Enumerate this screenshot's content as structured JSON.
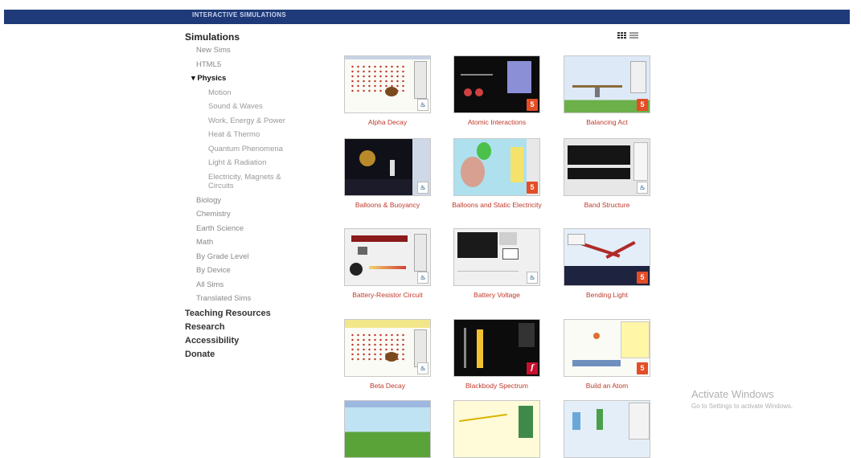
{
  "header": {
    "brand": "INTERACTIVE SIMULATIONS"
  },
  "sidebar": {
    "simulations_label": "Simulations",
    "level1_top": [
      "New Sims",
      "HTML5"
    ],
    "physics_label": "▾ Physics",
    "physics_children": [
      "Motion",
      "Sound & Waves",
      "Work, Energy & Power",
      "Heat & Thermo",
      "Quantum Phenomena",
      "Light & Radiation"
    ],
    "physics_last_child": "Electricity, Magnets & Circuits",
    "level1_rest": [
      "Biology",
      "Chemistry",
      "Earth Science",
      "Math",
      "By Grade Level",
      "By Device",
      "All Sims",
      "Translated Sims"
    ],
    "bottom_links": [
      "Teaching Resources",
      "Research",
      "Accessibility",
      "Donate"
    ]
  },
  "view_toggle": {
    "grid_icon": "grid-view-icon",
    "list_icon": "list-view-icon"
  },
  "sims": [
    {
      "title": "Alpha Decay",
      "badge": "java",
      "badge_text": "♨"
    },
    {
      "title": "Atomic Interactions",
      "badge": "html5",
      "badge_text": "5"
    },
    {
      "title": "Balancing Act",
      "badge": "html5",
      "badge_text": "5"
    },
    {
      "title": "Balloons & Buoyancy",
      "badge": "java",
      "badge_text": "♨"
    },
    {
      "title": "Balloons and Static Electricity",
      "badge": "html5",
      "badge_text": "5"
    },
    {
      "title": "Band Structure",
      "badge": "java",
      "badge_text": "♨"
    },
    {
      "title": "Battery-Resistor Circuit",
      "badge": "java",
      "badge_text": "♨"
    },
    {
      "title": "Battery Voltage",
      "badge": "java",
      "badge_text": "♨"
    },
    {
      "title": "Bending Light",
      "badge": "html5",
      "badge_text": "5"
    },
    {
      "title": "Beta Decay",
      "badge": "java",
      "badge_text": "♨"
    },
    {
      "title": "Blackbody Spectrum",
      "badge": "flash",
      "badge_text": "f"
    },
    {
      "title": "Build an Atom",
      "badge": "html5",
      "badge_text": "5"
    }
  ],
  "watermark": {
    "line1": "Activate Windows",
    "line2": "Go to Settings to activate Windows."
  },
  "colors": {
    "header": "#1f3a78",
    "sim_title": "#c0392b",
    "html5_badge": "#e44d26"
  }
}
